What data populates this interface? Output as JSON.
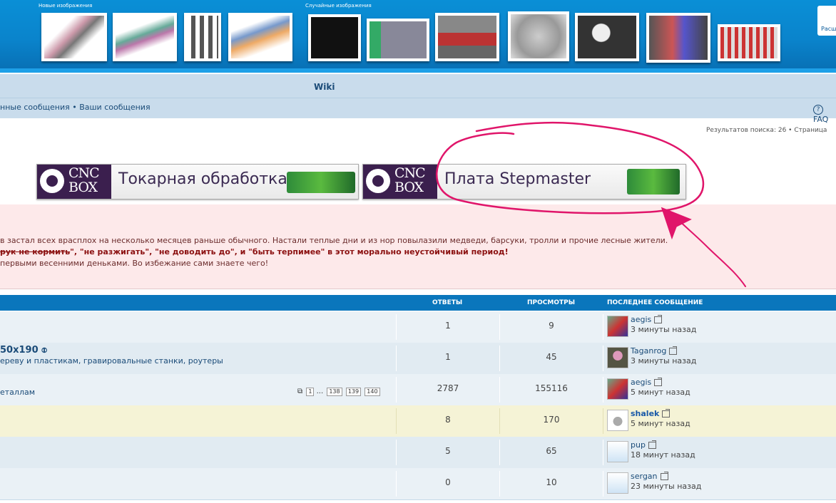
{
  "header": {
    "new_images_label": "Новые изображения",
    "random_images_label": "Случайные изображения",
    "side_text": "Расш"
  },
  "nav": {
    "wiki": "Wiki",
    "breadcrumb": "нные сообщения • Ваши сообщения",
    "faq": "FAQ"
  },
  "search": {
    "results_text": "Результатов поиска: 26 • Страница"
  },
  "banners": [
    {
      "brand_top": "CNC",
      "brand_bottom": "BOX",
      "text": "Токарная обработка"
    },
    {
      "brand_top": "CNC",
      "brand_bottom": "BOX",
      "text": "Плата Stepmaster"
    }
  ],
  "notice": {
    "line1": "в застал всех врасплох на несколько месяцев раньше обычного. Настали теплые дни и из нор повылазили медведи, барсуки, тролли и прочие лесные жители.",
    "line2_strike": "рук не кормить",
    "line2_rest": "\", \"не разжигать\", \"не доводить до\", и \"быть терпимее\" в этот морально неустойчивый период!",
    "line3": "первыми весенними деньками. Во избежание сами знаете чего!"
  },
  "table": {
    "col_replies": "ОТВЕТЫ",
    "col_views": "ПРОСМОТРЫ",
    "col_last": "ПОСЛЕДНЕЕ СООБЩЕНИЕ",
    "rows": [
      {
        "title": "",
        "sub": "",
        "replies": "1",
        "views": "9",
        "user": "aegis",
        "ago": "3 минуты назад"
      },
      {
        "title": "50x190",
        "sub": "ереву и пластикам, гравировальные станки, роутеры",
        "replies": "1",
        "views": "45",
        "user": "Taganrog",
        "ago": "3 минуты назад"
      },
      {
        "title": "",
        "sub": "еталлам",
        "replies": "2787",
        "views": "155116",
        "user": "aegis",
        "ago": "5 минут назад",
        "pages": [
          "1",
          "...",
          "138",
          "139",
          "140"
        ]
      },
      {
        "title": "",
        "sub": "",
        "replies": "8",
        "views": "170",
        "user": "shalek",
        "ago": "5 минут назад"
      },
      {
        "title": "",
        "sub": "",
        "replies": "5",
        "views": "65",
        "user": "pup",
        "ago": "18 минут назад"
      },
      {
        "title": "",
        "sub": "",
        "replies": "0",
        "views": "10",
        "user": "sergan",
        "ago": "23 минуты назад"
      }
    ]
  }
}
